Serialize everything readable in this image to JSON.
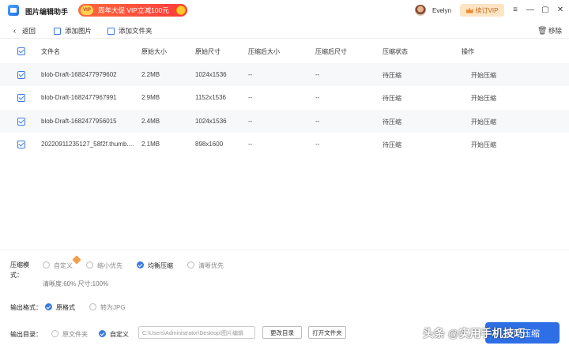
{
  "app": {
    "title": "图片编辑助手"
  },
  "promo": {
    "badge": "VIP",
    "text": "周年大促 VIP立减100元"
  },
  "user": {
    "name": "Evelyn"
  },
  "renew": {
    "label": "续订VIP"
  },
  "window": {
    "minimize": "—",
    "restore": "▢",
    "close": "✕"
  },
  "toolbar": {
    "back": "返回",
    "add_image": "添加图片",
    "add_folder": "添加文件夹",
    "remove": "移除"
  },
  "table": {
    "headers": [
      "文件名",
      "原始大小",
      "原始尺寸",
      "压缩后大小",
      "压缩后尺寸",
      "压缩状态",
      "操作"
    ],
    "rows": [
      {
        "name": "blob-Draft-1682477979602",
        "size": "2.2MB",
        "dims": "1024x1536",
        "new_size": "--",
        "new_dims": "--",
        "status": "待压缩",
        "action": "开始压缩"
      },
      {
        "name": "blob-Draft-1682477967991",
        "size": "2.9MB",
        "dims": "1152x1536",
        "new_size": "--",
        "new_dims": "--",
        "status": "待压缩",
        "action": "开始压缩"
      },
      {
        "name": "blob-Draft-1682477956015",
        "size": "2.4MB",
        "dims": "1024x1536",
        "new_size": "--",
        "new_dims": "--",
        "status": "待压缩",
        "action": "开始压缩"
      },
      {
        "name": "20220911235127_58f2f.thumb....",
        "size": "2.1MB",
        "dims": "898x1600",
        "new_size": "--",
        "new_dims": "--",
        "status": "待压缩",
        "action": "开始压缩"
      }
    ]
  },
  "settings": {
    "mode_label_1": "压缩模",
    "mode_label_2": "式：",
    "mode_options": [
      "自定义",
      "缩小优先",
      "均衡压缩",
      "清晰优先"
    ],
    "mode_selected": "均衡压缩",
    "mode_info": "清晰度:60%    尺寸:100%",
    "format_label": "输出格式：",
    "format_options": [
      "原格式",
      "转为JPG"
    ],
    "format_selected": "原格式",
    "dir_label": "输出目录：",
    "dir_options": [
      "原文件夹",
      "自定义"
    ],
    "dir_selected": "自定义",
    "dir_path": "C:\\Users\\Administrator\\Desktop\\图片编辑",
    "change_dir": "更改目录",
    "open_folder": "打开文件夹",
    "start": "开始压缩"
  },
  "watermark": "头条 @实用手机技巧",
  "colors": {
    "accent": "#2f6fe6",
    "promo": "#ff4a3b",
    "renew_bg": "#fde4c3"
  }
}
